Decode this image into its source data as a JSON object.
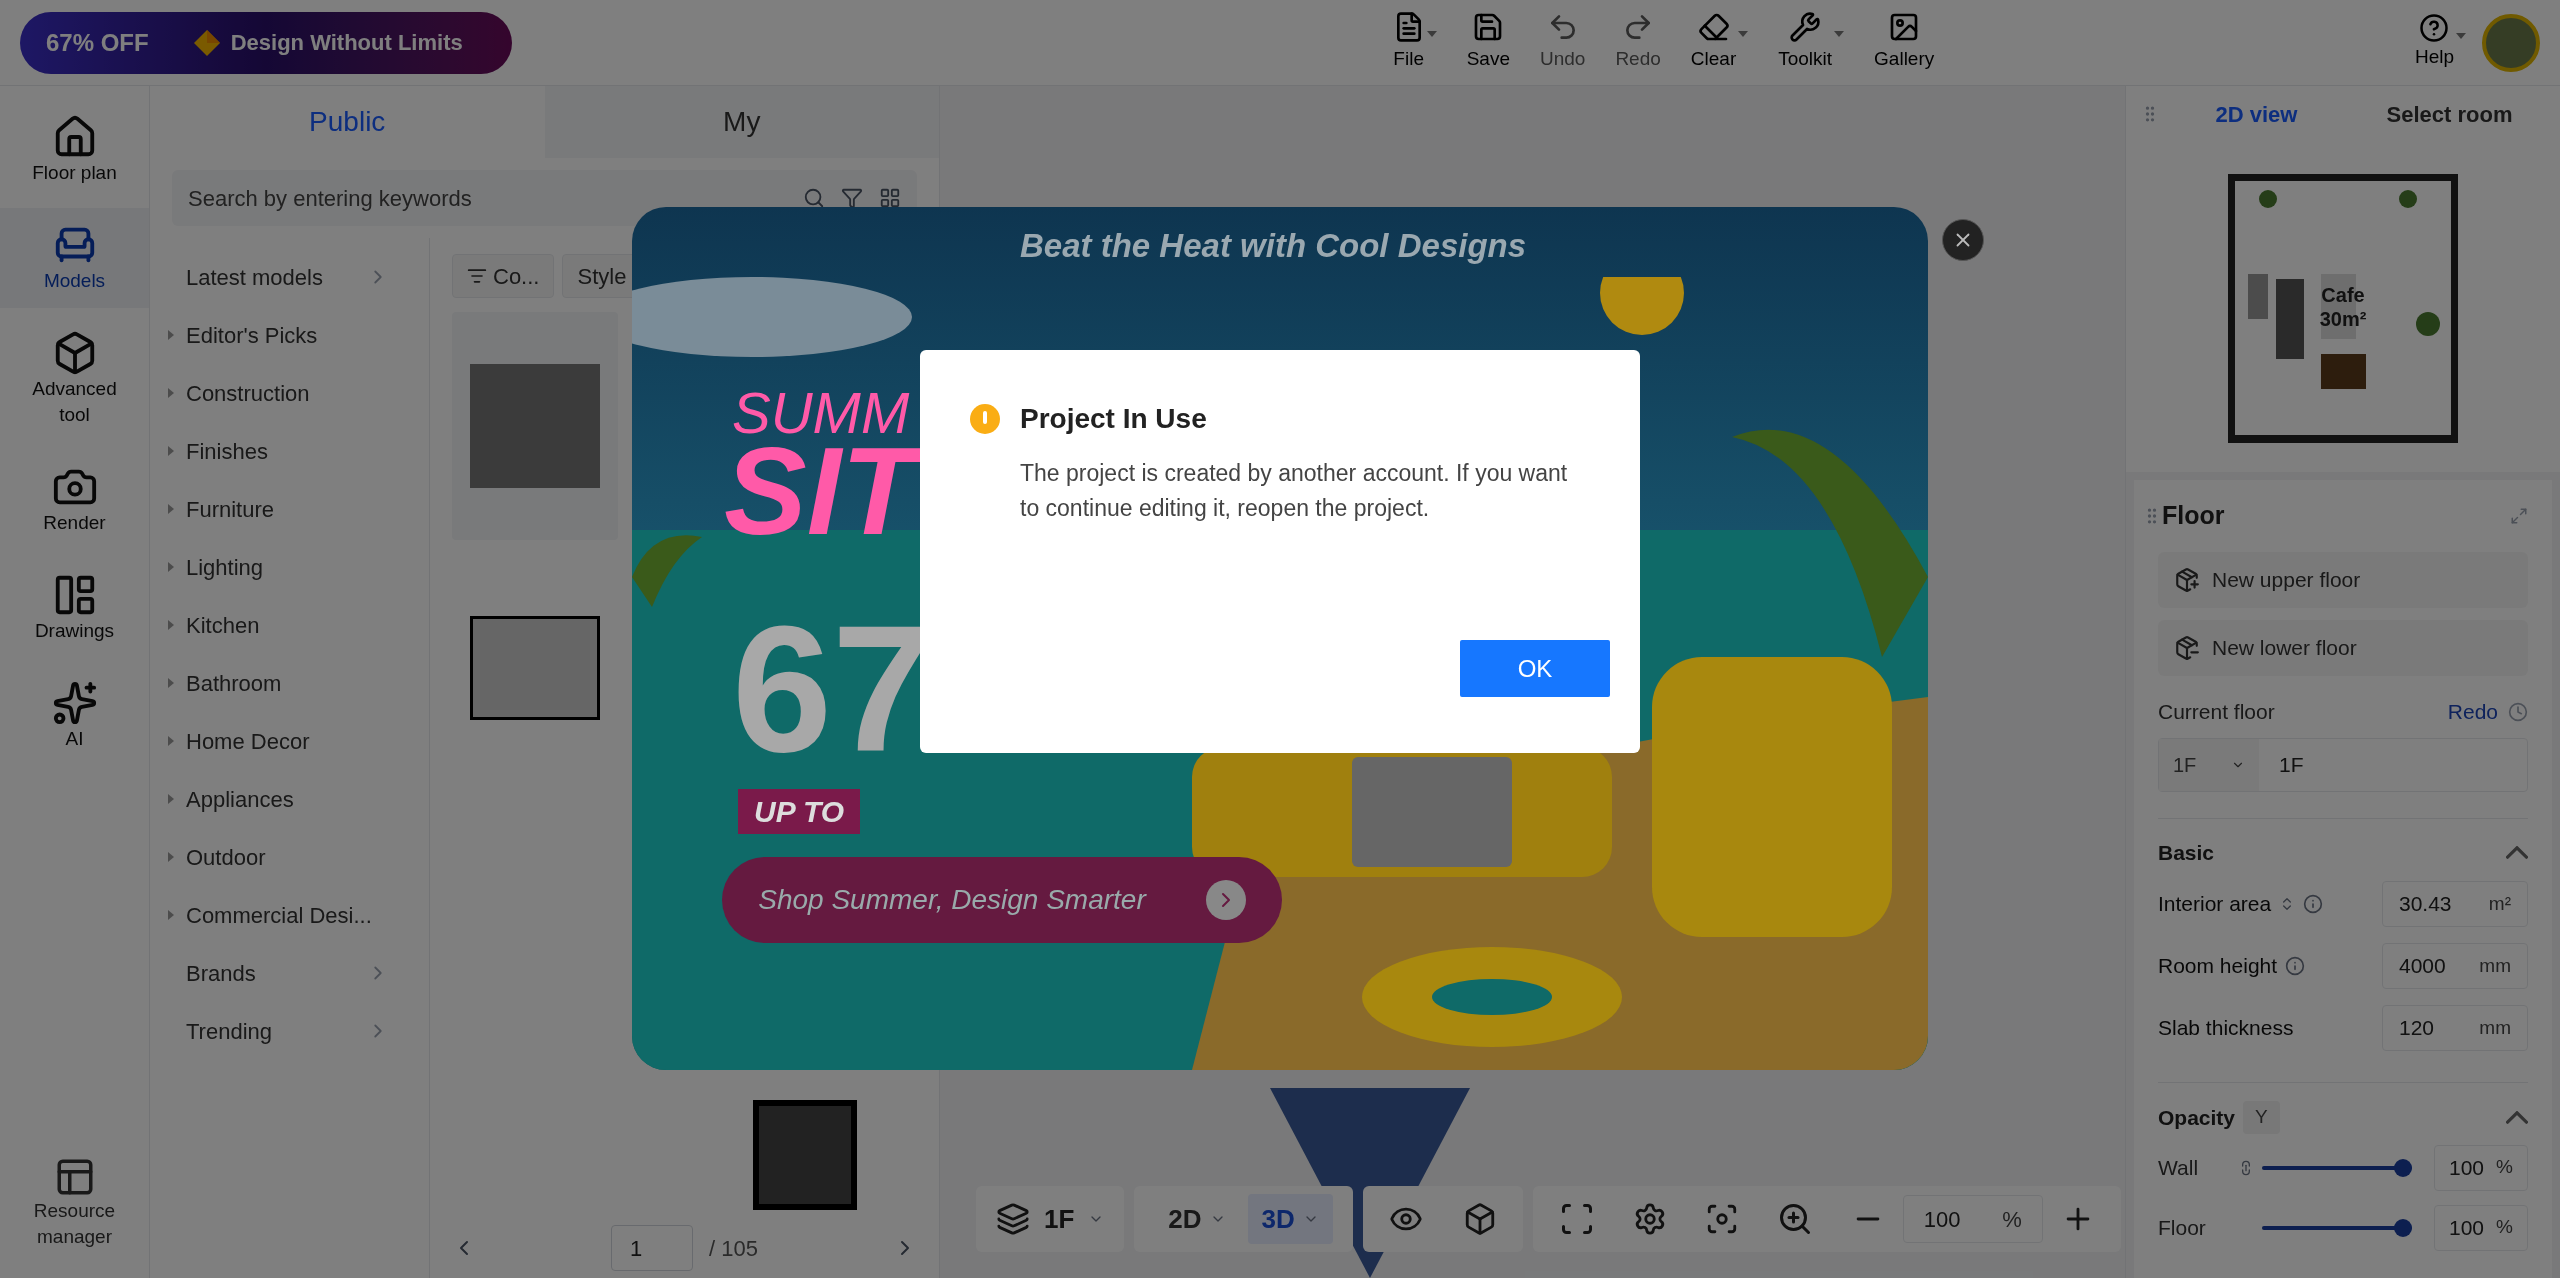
{
  "promo_badge": {
    "discount": "67% OFF",
    "slogan": "Design Without Limits"
  },
  "toolbar": [
    {
      "label": "File",
      "disabled": false,
      "dropdown": true
    },
    {
      "label": "Save",
      "disabled": false,
      "dropdown": false
    },
    {
      "label": "Undo",
      "disabled": true,
      "dropdown": false
    },
    {
      "label": "Redo",
      "disabled": true,
      "dropdown": false
    },
    {
      "label": "Clear",
      "disabled": false,
      "dropdown": true
    },
    {
      "label": "Toolkit",
      "disabled": false,
      "dropdown": true
    },
    {
      "label": "Gallery",
      "disabled": false,
      "dropdown": false
    }
  ],
  "help": {
    "label": "Help",
    "dropdown": true
  },
  "rail": [
    {
      "label": "Floor plan",
      "selected": false
    },
    {
      "label": "Models",
      "selected": true
    },
    {
      "label": "Advanced tool",
      "selected": false
    },
    {
      "label": "Render",
      "selected": false
    },
    {
      "label": "Drawings",
      "selected": false
    },
    {
      "label": "AI",
      "selected": false
    }
  ],
  "resource_manager": {
    "label": "Resource manager"
  },
  "library": {
    "tabs": [
      {
        "label": "Public",
        "selected": true
      },
      {
        "label": "My",
        "selected": false
      }
    ],
    "search": {
      "placeholder": "Search by entering keywords"
    },
    "categories": [
      {
        "label": "Latest models",
        "kind": "link"
      },
      {
        "label": "Editor's Picks",
        "kind": "group"
      },
      {
        "label": "Construction",
        "kind": "group"
      },
      {
        "label": "Finishes",
        "kind": "group"
      },
      {
        "label": "Furniture",
        "kind": "group"
      },
      {
        "label": "Lighting",
        "kind": "group"
      },
      {
        "label": "Kitchen",
        "kind": "group"
      },
      {
        "label": "Bathroom",
        "kind": "group"
      },
      {
        "label": "Home Decor",
        "kind": "group"
      },
      {
        "label": "Appliances",
        "kind": "group"
      },
      {
        "label": "Outdoor",
        "kind": "group"
      },
      {
        "label": "Commercial Desi...",
        "kind": "group"
      },
      {
        "label": "Brands",
        "kind": "link"
      },
      {
        "label": "Trending",
        "kind": "link"
      }
    ],
    "filters": [
      "Co...",
      "Style"
    ],
    "pagination": {
      "page": "1",
      "total": "/ 105"
    }
  },
  "view_tabs": [
    {
      "label": "2D view",
      "selected": true
    },
    {
      "label": "Select room",
      "selected": false
    }
  ],
  "floor_plan": {
    "room": "Cafe",
    "area": "30m²"
  },
  "floor_panel": {
    "title": "Floor",
    "actions": [
      "New upper floor",
      "New lower floor"
    ],
    "current_floor": {
      "label": "Current floor",
      "link": "Redo",
      "select": "1F",
      "value": "1F"
    },
    "basic": {
      "title": "Basic",
      "expanded": true,
      "fields": [
        {
          "label": "Interior area",
          "sortable": true,
          "info": true,
          "value": "30.43",
          "unit": "m²"
        },
        {
          "label": "Room height",
          "sortable": false,
          "info": true,
          "value": "4000",
          "unit": "mm"
        },
        {
          "label": "Slab thickness",
          "sortable": false,
          "info": false,
          "value": "120",
          "unit": "mm"
        }
      ]
    },
    "opacity": {
      "title": "Opacity",
      "tag": "Y",
      "expanded": true,
      "sliders": [
        {
          "label": "Wall",
          "level": 1,
          "value": "100",
          "unit": "%"
        },
        {
          "label": "Floor",
          "level": 1,
          "value": "100",
          "unit": "%"
        }
      ]
    }
  },
  "view_toolbar": {
    "floor": "1F",
    "modes": [
      {
        "label": "2D",
        "selected": false
      },
      {
        "label": "3D",
        "selected": true
      }
    ],
    "zoom": "100",
    "zoom_unit": "%"
  },
  "promo": {
    "headline": "Beat the Heat with Cool Designs",
    "word_1": "SUMM",
    "word_2": "SIT",
    "number": "67",
    "badge": "UP TO",
    "button": "Shop Summer, Design Smarter"
  },
  "dialog": {
    "title": "Project In Use",
    "message": "The project is created by another account. If you want to continue editing it, reopen the project.",
    "button": "OK"
  }
}
